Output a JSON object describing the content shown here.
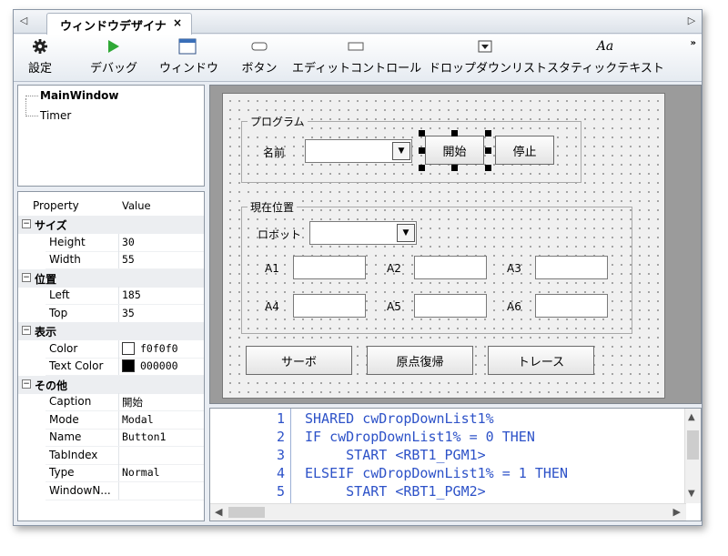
{
  "tab": {
    "title": "ウィンドウデザイナ",
    "close": "×",
    "left_arrow": "◁",
    "right_arrow": "▷"
  },
  "toolbar": {
    "items": [
      {
        "label": "設定",
        "icon": "gear-icon"
      },
      {
        "label": "デバッグ",
        "icon": "play-icon"
      },
      {
        "label": "ウィンドウ",
        "icon": "window-icon"
      },
      {
        "label": "ボタン",
        "icon": "button-shape-icon"
      },
      {
        "label": "エディットコントロール",
        "icon": "edit-control-icon"
      },
      {
        "label": "ドロップダウンリスト",
        "icon": "dropdown-icon"
      },
      {
        "label": "スタティックテキスト",
        "icon": "static-text-icon",
        "glyph": "Aa"
      }
    ],
    "more": "»",
    "play_color": "#2fa836"
  },
  "tree": {
    "items": [
      "MainWindow",
      "Timer"
    ]
  },
  "properties": {
    "header": {
      "key": "Property",
      "value": "Value"
    },
    "groups": [
      {
        "name": "サイズ",
        "rows": [
          {
            "key": "Height",
            "value": "30"
          },
          {
            "key": "Width",
            "value": "55"
          }
        ]
      },
      {
        "name": "位置",
        "rows": [
          {
            "key": "Left",
            "value": "185"
          },
          {
            "key": "Top",
            "value": "35"
          }
        ]
      },
      {
        "name": "表示",
        "rows": [
          {
            "key": "Color",
            "value": "f0f0f0",
            "swatch": "#ffffff"
          },
          {
            "key": "Text Color",
            "value": "000000",
            "swatch": "#000000"
          }
        ]
      },
      {
        "name": "その他",
        "rows": [
          {
            "key": "Caption",
            "value": "開始"
          },
          {
            "key": "Mode",
            "value": "Modal"
          },
          {
            "key": "Name",
            "value": "Button1"
          },
          {
            "key": "TabIndex",
            "value": ""
          },
          {
            "key": "Type",
            "value": "Normal"
          },
          {
            "key": "WindowN...",
            "value": ""
          }
        ]
      }
    ],
    "collapse_glyph": "⊟"
  },
  "designer": {
    "program_group": "プログラム",
    "name_label": "名前",
    "start_button": "開始",
    "stop_button": "停止",
    "position_group": "現在位置",
    "robot_label": "ロボット",
    "axes": [
      "A1",
      "A2",
      "A3",
      "A4",
      "A5",
      "A6"
    ],
    "servo_button": "サーボ",
    "home_button": "原点復帰",
    "trace_button": "トレース"
  },
  "code": {
    "lines": [
      {
        "no": "1",
        "text": "SHARED cwDropDownList1%"
      },
      {
        "no": "2",
        "text": "IF cwDropDownList1% = 0 THEN"
      },
      {
        "no": "3",
        "text": "     START <RBT1_PGM1>"
      },
      {
        "no": "4",
        "text": "ELSEIF cwDropDownList1% = 1 THEN"
      },
      {
        "no": "5",
        "text": "     START <RBT1_PGM2>"
      }
    ]
  }
}
